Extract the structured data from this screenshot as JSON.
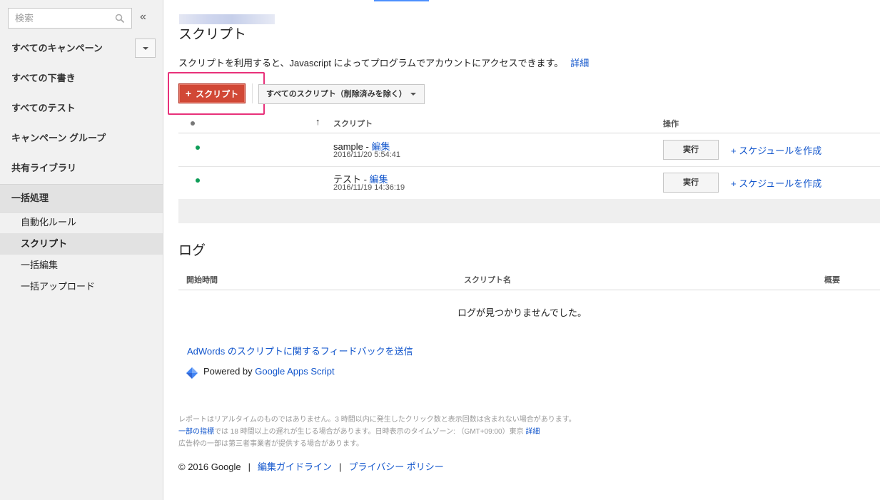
{
  "sidebar": {
    "search_placeholder": "検索",
    "collapse_glyph": "«",
    "nav": [
      {
        "label": "すべてのキャンペーン"
      },
      {
        "label": "すべての下書き"
      },
      {
        "label": "すべてのテスト"
      },
      {
        "label": "キャンペーン グループ"
      },
      {
        "label": "共有ライブラリ"
      },
      {
        "label": "一括処理"
      }
    ],
    "sub_nav": [
      {
        "label": "自動化ルール"
      },
      {
        "label": "スクリプト"
      },
      {
        "label": "一括編集"
      },
      {
        "label": "一括アップロード"
      }
    ]
  },
  "main": {
    "title": "スクリプト",
    "description": "スクリプトを利用すると、Javascript によってプログラムでアカウントにアクセスできます。",
    "details_link": "詳細",
    "add_button": "スクリプト",
    "filter_label": "すべてのスクリプト（削除済みを除く）",
    "table": {
      "headers": {
        "sort_arrow": "↑",
        "script": "スクリプト",
        "actions": "操作"
      },
      "rows": [
        {
          "name": "sample",
          "separator": " - ",
          "edit": "編集",
          "date": "2016/11/20 5:54:41",
          "run": "実行",
          "schedule": "+ スケジュールを作成"
        },
        {
          "name": "テスト",
          "separator": " - ",
          "edit": "編集",
          "date": "2016/11/19 14:36:19",
          "run": "実行",
          "schedule": "+ スケジュールを作成"
        }
      ]
    },
    "log": {
      "title": "ログ",
      "headers": {
        "start": "開始時間",
        "script_name": "スクリプト名",
        "summary": "概要"
      },
      "empty": "ログが見つかりませんでした。"
    },
    "feedback_link": "AdWords のスクリプトに関するフィードバックを送信",
    "powered_by_prefix": "Powered by ",
    "powered_by_link": "Google Apps Script",
    "disclaimer": {
      "line1": "レポートはリアルタイムのものではありません。3 時間以内に発生したクリック数と表示回数は含まれない場合があります。",
      "line2_link": "一部の指標",
      "line2_text": "では 18 時間以上の遅れが生じる場合があります。日時表示のタイムゾーン: （GMT+09:00）東京 ",
      "line2_detail": "詳細",
      "line3": "広告枠の一部は第三者事業者が提供する場合があります。"
    },
    "footer": {
      "copyright": "© 2016 Google",
      "sep": "|",
      "guidelines": "編集ガイドライン",
      "privacy": "プライバシー ポリシー"
    }
  },
  "colors": {
    "accent_red": "#d14836",
    "highlight_pink": "#e8317a",
    "link_blue": "#1155cc",
    "status_green": "#0f9d58",
    "tab_indicator": "#4d90fe"
  }
}
